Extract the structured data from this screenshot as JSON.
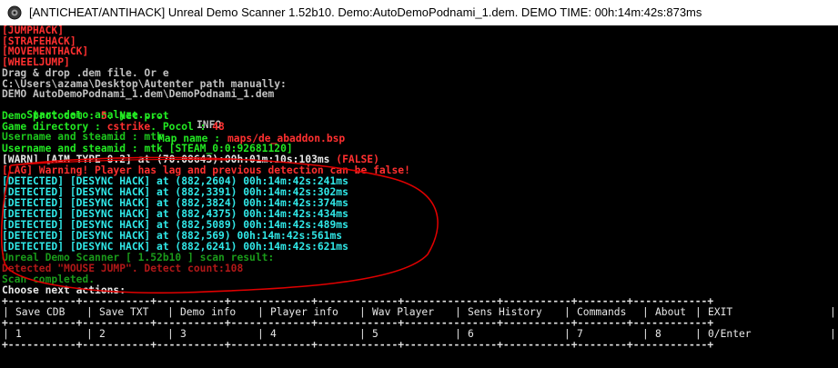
{
  "window": {
    "title": "[ANTICHEAT/ANTIHACK] Unreal Demo Scanner 1.52b10. Demo:AutoDemoPodnami_1.dem. DEMO TIME: 00h:14m:42s:873ms"
  },
  "console": {
    "l_jumphack": "[JUMPHACK]",
    "l_strafehack": "[STRAFEHACK]",
    "l_movementhack": "[MOVEMENTHACK]",
    "l_wheeljump": "[WHEELJUMP]",
    "l_dragdrop": "Drag & drop .dem file. Or e",
    "l_path_prompt": "C:\\Users\\azama\\Desktop\\Autenter path manually:",
    "l_demo_path": "DEMO AutoDemoPodnami_1.dem\\DemoPodnami_1.dem",
    "l_start_analyze": "Start demo analyze.....",
    "l_info": "INFO",
    "l_protocol_label": "Demo protocol : ",
    "l_protocol_value": "5",
    "l_protocol_rest": ". Net prot",
    "l_gamedir_label": "Game directory : ",
    "l_gamedir_value": "cstrike",
    "l_gamedir_rest": ". Pocol : ",
    "l_gamedir_num": "48",
    "l_username_garbled": "Username and steamid : mtk",
    "l_mapname_label": "Map name : ",
    "l_mapname_value": "maps/de_abaddon.bsp",
    "l_username_label": "Username and steamid : ",
    "l_username_value": "mtk [STEAM_0:0:92681120]",
    "l_warn_aim": "[WARN] [AIM TYPE 8.2] at (70.08643):00h:01m:10s:103ms",
    "l_warn_false": "(FALSE)",
    "l_lag_warning": "[LAG] Warning! Player has lag and previous detection can be false!",
    "detections": [
      "[DETECTED] [DESYNC HACK] at (882,2604) 00h:14m:42s:241ms",
      "[DETECTED] [DESYNC HACK] at (882,3391) 00h:14m:42s:302ms",
      "[DETECTED] [DESYNC HACK] at (882,3824) 00h:14m:42s:374ms",
      "[DETECTED] [DESYNC HACK] at (882,4375) 00h:14m:42s:434ms",
      "[DETECTED] [DESYNC HACK] at (882,5089) 00h:14m:42s:489ms",
      "[DETECTED] [DESYNC HACK] at (882,569) 00h:14m:42s:561ms",
      "[DETECTED] [DESYNC HACK] at (882,6241) 00h:14m:42s:621ms"
    ],
    "l_scan_result": "Unreal Demo Scanner [ 1.52b10 ] scan result:",
    "l_mouse_jump": "Detected \"MOUSE JUMP\". Detect count:108",
    "l_scan_completed": "Scan completed.",
    "l_choose": "Choose next actions:"
  },
  "menu": {
    "items": [
      {
        "label": "Save CDB",
        "key": "1"
      },
      {
        "label": "Save TXT",
        "key": "2"
      },
      {
        "label": "Demo info",
        "key": "3"
      },
      {
        "label": "Player info",
        "key": "4"
      },
      {
        "label": "Wav Player",
        "key": "5"
      },
      {
        "label": "Sens History",
        "key": "6"
      },
      {
        "label": "Commands",
        "key": "7"
      },
      {
        "label": "About",
        "key": "8"
      },
      {
        "label": "EXIT",
        "key": "0/Enter"
      }
    ]
  },
  "colors": {
    "background": "#000000",
    "red": "#ff3030",
    "green": "#22e822",
    "cyan": "#30e8e8",
    "annotation": "#e00000"
  }
}
